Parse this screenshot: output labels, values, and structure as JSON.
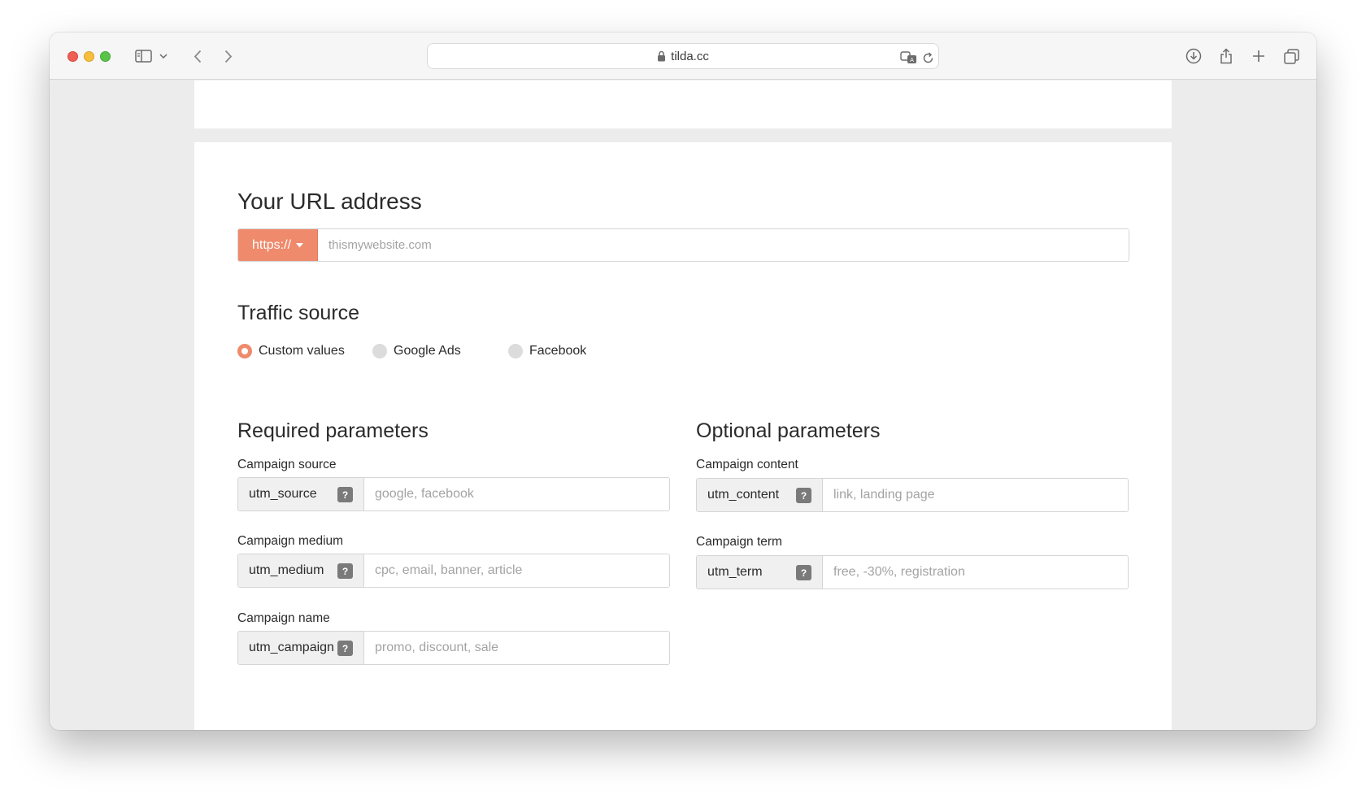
{
  "browser": {
    "url": "tilda.cc"
  },
  "url_section": {
    "title": "Your URL address",
    "protocol": "https://",
    "placeholder": "thismywebsite.com"
  },
  "traffic_section": {
    "title": "Traffic source",
    "options": [
      {
        "label": "Custom values",
        "selected": true
      },
      {
        "label": "Google Ads",
        "selected": false
      },
      {
        "label": "Facebook",
        "selected": false
      }
    ]
  },
  "required": {
    "title": "Required parameters",
    "fields": [
      {
        "label": "Campaign source",
        "key": "utm_source",
        "placeholder": "google, facebook"
      },
      {
        "label": "Campaign medium",
        "key": "utm_medium",
        "placeholder": "cpc, email, banner, article"
      },
      {
        "label": "Campaign name",
        "key": "utm_campaign",
        "placeholder": "promo, discount, sale"
      }
    ]
  },
  "optional": {
    "title": "Optional parameters",
    "fields": [
      {
        "label": "Campaign content",
        "key": "utm_content",
        "placeholder": "link, landing page"
      },
      {
        "label": "Campaign term",
        "key": "utm_term",
        "placeholder": "free, -30%, registration"
      }
    ]
  },
  "help_glyph": "?",
  "colors": {
    "accent": "#ef8a6d",
    "help_icon": "#7a7a7a"
  }
}
